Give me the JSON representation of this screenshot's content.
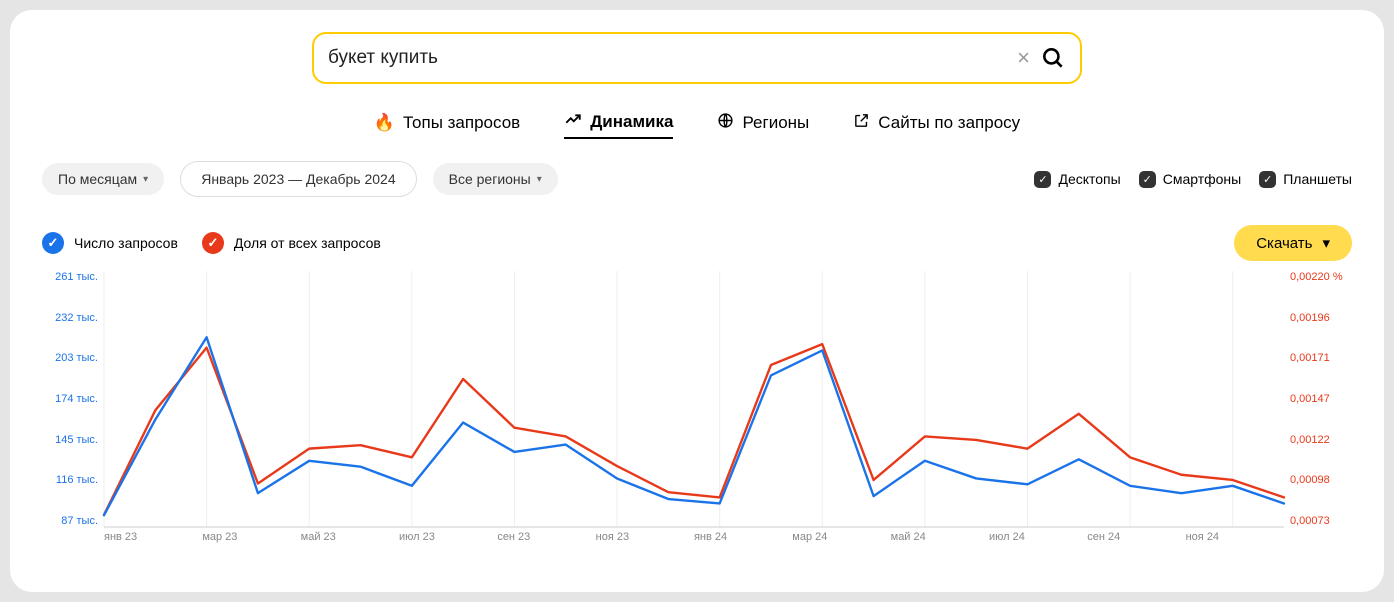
{
  "search": {
    "value": "букет купить"
  },
  "tabs": [
    {
      "icon": "flame",
      "label": "Топы запросов"
    },
    {
      "icon": "trend",
      "label": "Динамика",
      "active": true
    },
    {
      "icon": "globe",
      "label": "Регионы"
    },
    {
      "icon": "ext",
      "label": "Сайты по запросу"
    }
  ],
  "filters": {
    "period_label": "По месяцам",
    "range_label": "Январь 2023 — Декабрь 2024",
    "region_label": "Все регионы"
  },
  "devices": {
    "desktop": "Десктопы",
    "phone": "Смартфоны",
    "tablet": "Планшеты"
  },
  "legend": {
    "s1": "Число запросов",
    "s2": "Доля от всех запросов"
  },
  "download": "Скачать",
  "y_left": [
    "261 тыс.",
    "232 тыс.",
    "203 тыс.",
    "174 тыс.",
    "145 тыс.",
    "116 тыс.",
    "87 тыс."
  ],
  "y_right": [
    "0,00220 %",
    "0,00196",
    "0,00171",
    "0,00147",
    "0,00122",
    "0,00098",
    "0,00073"
  ],
  "x_labels": [
    "янв 23",
    "мар 23",
    "май 23",
    "июл 23",
    "сен 23",
    "ноя 23",
    "янв 24",
    "мар 24",
    "май 24",
    "июл 24",
    "сен 24",
    "ноя 24"
  ],
  "chart_data": {
    "type": "line",
    "title": "",
    "x_categories": [
      "янв 23",
      "фев 23",
      "мар 23",
      "апр 23",
      "май 23",
      "июн 23",
      "июл 23",
      "авг 23",
      "сен 23",
      "окт 23",
      "ноя 23",
      "дек 23",
      "янв 24",
      "фев 24",
      "мар 24",
      "апр 24",
      "май 24",
      "июн 24",
      "июл 24",
      "авг 24",
      "сен 24",
      "окт 24",
      "ноя 24",
      "дек 24"
    ],
    "series": [
      {
        "name": "Число запросов",
        "axis": "left",
        "color": "#1a73e8",
        "values": [
          95000,
          160000,
          216000,
          110000,
          132000,
          128000,
          115000,
          158000,
          138000,
          143000,
          120000,
          106000,
          103000,
          190000,
          207000,
          108000,
          132000,
          120000,
          116000,
          133000,
          115000,
          110000,
          115000,
          103000
        ]
      },
      {
        "name": "Доля от всех запросов",
        "axis": "right",
        "color": "#e8391a",
        "values": [
          0.0008,
          0.0014,
          0.00176,
          0.00098,
          0.00118,
          0.0012,
          0.00113,
          0.00158,
          0.0013,
          0.00125,
          0.00108,
          0.00093,
          0.0009,
          0.00166,
          0.00178,
          0.001,
          0.00125,
          0.00123,
          0.00118,
          0.00138,
          0.00113,
          0.00103,
          0.001,
          0.0009
        ]
      }
    ],
    "y_left_range": [
      87000,
      261000
    ],
    "y_right_range": [
      0.00073,
      0.0022
    ]
  }
}
